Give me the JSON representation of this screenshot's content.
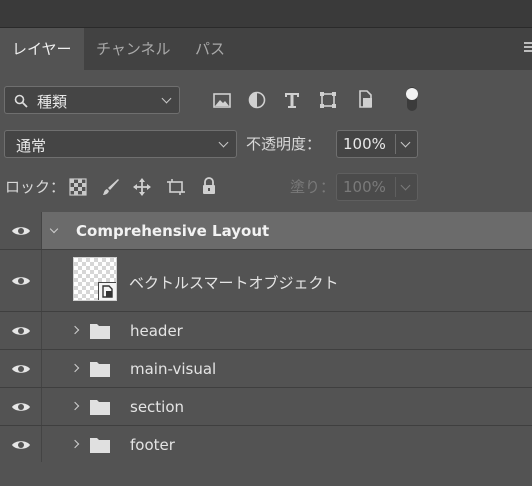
{
  "tabs": [
    {
      "label": "レイヤー",
      "active": true
    },
    {
      "label": "チャンネル",
      "active": false
    },
    {
      "label": "パス",
      "active": false
    }
  ],
  "filter": {
    "label": "種類",
    "icons": [
      "image-filter-icon",
      "adjustment-filter-icon",
      "type-filter-icon",
      "shape-filter-icon",
      "smart-object-filter-icon",
      "filter-toggle-icon"
    ]
  },
  "blend": {
    "mode": "通常",
    "opacity_label": "不透明度：",
    "opacity_value": "100%"
  },
  "lock": {
    "label": "ロック：",
    "icons": [
      "lock-transparent-pixels-icon",
      "lock-image-pixels-icon",
      "lock-position-icon",
      "lock-artboard-icon",
      "lock-all-icon"
    ],
    "fill_label": "塗り：",
    "fill_value": "100%"
  },
  "layers": [
    {
      "name": "Comprehensive Layout",
      "type": "group",
      "expanded": true,
      "selected": true
    },
    {
      "name": "ベクトルスマートオブジェクト",
      "type": "smart-object"
    },
    {
      "name": "header",
      "type": "group",
      "expanded": false
    },
    {
      "name": "main-visual",
      "type": "group",
      "expanded": false
    },
    {
      "name": "section",
      "type": "group",
      "expanded": false
    },
    {
      "name": "footer",
      "type": "group",
      "expanded": false
    }
  ],
  "colors": {
    "panel_bg": "#535353",
    "tab_bar_bg": "#424242",
    "selected_row_bg": "#6b6b6b"
  }
}
